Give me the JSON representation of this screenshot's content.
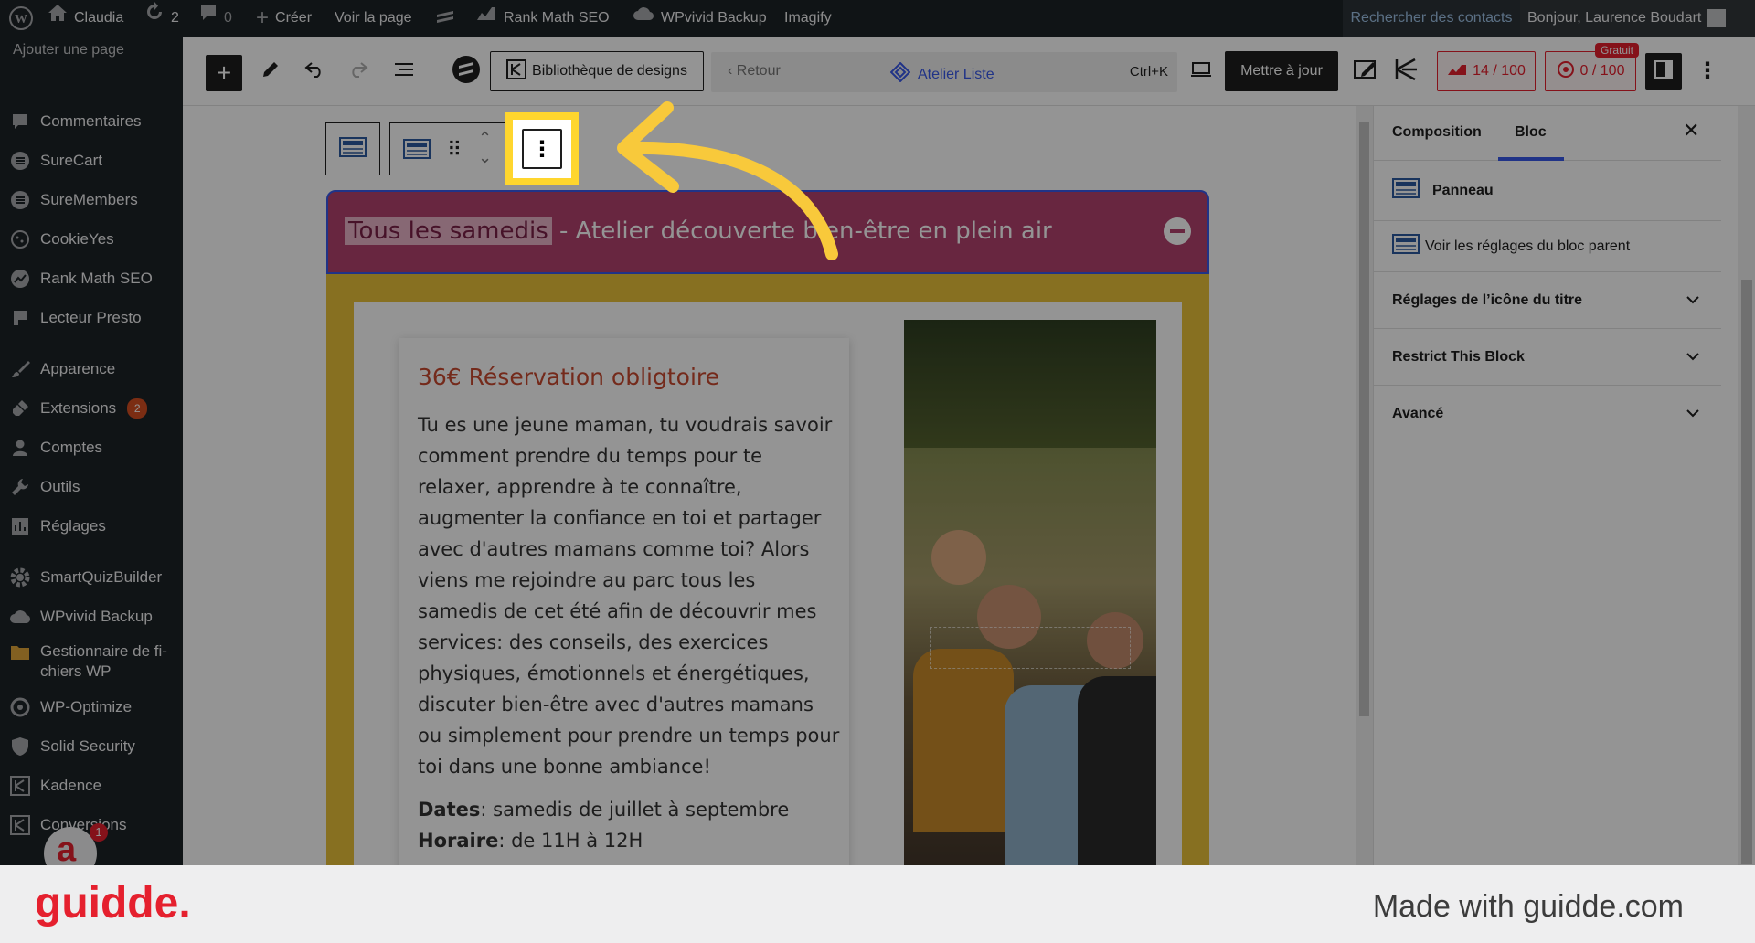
{
  "adminbar": {
    "site_name": "Claudia",
    "updates_count": "2",
    "comments_count": "0",
    "create_label": "Créer",
    "view_page_label": "Voir la page",
    "rankmath_label": "Rank Math SEO",
    "wpvivid_label": "WPvivid Backup",
    "imagify_label": "Imagify",
    "search_contacts_label": "Rechercher des contacts",
    "greeting": "Bonjour, Laurence Boudart"
  },
  "sidebar": {
    "top_truncated": "Ajouter une page",
    "items": [
      {
        "label": "Commentaires",
        "icon": "comment-icon"
      },
      {
        "label": "SureCart",
        "icon": "surecart-icon"
      },
      {
        "label": "SureMembers",
        "icon": "suremembers-icon"
      },
      {
        "label": "CookieYes",
        "icon": "cookie-icon"
      },
      {
        "label": "Rank Math SEO",
        "icon": "rankmath-icon"
      },
      {
        "label": "Lecteur Presto",
        "icon": "presto-icon"
      },
      {
        "label": "Apparence",
        "icon": "brush-icon"
      },
      {
        "label": "Extensions",
        "icon": "plugin-icon",
        "badge": "2"
      },
      {
        "label": "Comptes",
        "icon": "user-icon"
      },
      {
        "label": "Outils",
        "icon": "wrench-icon"
      },
      {
        "label": "Réglages",
        "icon": "settings-icon"
      },
      {
        "label": "SmartQuizBuilder",
        "icon": "gear-icon"
      },
      {
        "label": "WPvivid Backup",
        "icon": "cloud-icon"
      },
      {
        "label": "Gestionnaire de fi-chiers WP",
        "line1": "Gestionnaire de fi-",
        "line2": "chiers WP",
        "icon": "folder-icon"
      },
      {
        "label": "WP-Optimize",
        "icon": "optimize-icon"
      },
      {
        "label": "Solid Security",
        "icon": "shield-icon"
      },
      {
        "label": "Kadence",
        "icon": "kadence-icon"
      },
      {
        "label": "Conversions",
        "icon": "conversions-icon"
      }
    ],
    "bubble_badge": "1"
  },
  "toolbar": {
    "design_library_label": "Bibliothèque de designs",
    "back_label": "Retour",
    "doc_title": "Atelier Liste",
    "shortcut": "Ctrl+K",
    "update_label": "Mettre à jour",
    "seo_score": "14 / 100",
    "second_score": "0 / 100",
    "free_badge": "Gratuit"
  },
  "content": {
    "accordion_title_highlight": "Tous les samedis",
    "accordion_title_rest": "- Atelier découverte bien-être en plein air",
    "price_heading": "36€ Réservation obligtoire",
    "paragraph": "Tu es une jeune maman, tu voudrais savoir comment prendre du temps pour te relaxer, apprendre à te connaître, augmenter la confiance en toi et partager avec d'autres mamans comme toi? Alors viens me rejoindre au parc tous les samedis de cet été afin de découvrir mes services: des conseils, des exercices physiques, émotionnels et énergétiques, discuter bien-être avec d'autres mamans ou simplement pour prendre un temps pour toi dans une bonne ambiance!",
    "dates_label": "Dates",
    "dates_value": ": samedis de juillet à septembre",
    "hours_label": "Horaire",
    "hours_value": ": de 11H à 12H"
  },
  "rightpanel": {
    "tab_composition": "Composition",
    "tab_bloc": "Bloc",
    "block_name": "Panneau",
    "parent_link": "Voir les réglages du bloc parent",
    "section_icon": "Réglages de l’icône du titre",
    "section_restrict": "Restrict This Block",
    "section_advanced": "Avancé"
  },
  "footer": {
    "brand": "guidde.",
    "made_with": "Made with guidde.com"
  },
  "colors": {
    "admin_bg": "#1d2327",
    "accordion_title_bg": "#b4426f",
    "accordion_body_border": "#e8c23a",
    "highlight_frame": "#ffd62e",
    "arrow": "#f8c93b",
    "heading_color": "#c9492f",
    "brand_red": "#e5202e"
  }
}
